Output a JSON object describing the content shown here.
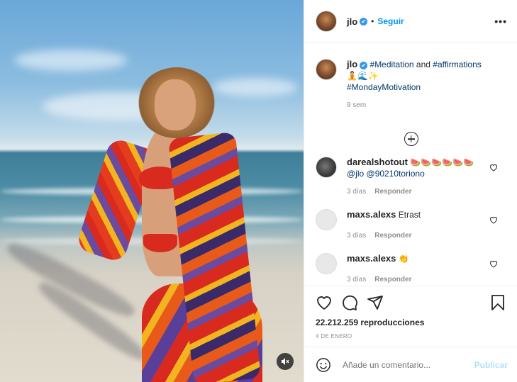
{
  "post": {
    "username": "jlo",
    "verified_mark": "✔",
    "separator": "•",
    "follow_label": "Seguir",
    "more_label": "•••"
  },
  "caption": {
    "username": "jlo",
    "tag1": "#Meditation",
    "and": " and ",
    "tag2": "#affirmations",
    "emojis": "🧘🌊✨",
    "tag3": "#MondayMotivation",
    "time": "9 sem"
  },
  "comments": [
    {
      "username": "darealshotout",
      "text": "🍉🍉🍉🍉🍉🍉",
      "mention1": "@jlo",
      "mention2": "@90210torionо",
      "time": "3 días",
      "reply": "Responder"
    },
    {
      "username": "maxs.alexs",
      "text": "Etrast",
      "time": "3 días",
      "reply": "Responder"
    },
    {
      "username": "maxs.alexs",
      "text": "👏",
      "time": "3 días",
      "reply": "Responder"
    }
  ],
  "stats": {
    "views": "22.212.259 reproducciones",
    "date": "4 DE ENERO"
  },
  "add_comment": {
    "placeholder": "Añade un comentario...",
    "publish": "Publicar"
  },
  "icons": {
    "like": "heart-icon",
    "comment": "comment-icon",
    "share": "share-icon",
    "save": "bookmark-icon",
    "emoji": "emoji-icon",
    "mute": "mute-icon",
    "more_comments": "plus-circle-icon"
  },
  "colors": {
    "accent": "#0095f6",
    "hashtag": "#00376b",
    "muted": "#8e8e8e",
    "publish_disabled": "#b2dffc"
  }
}
